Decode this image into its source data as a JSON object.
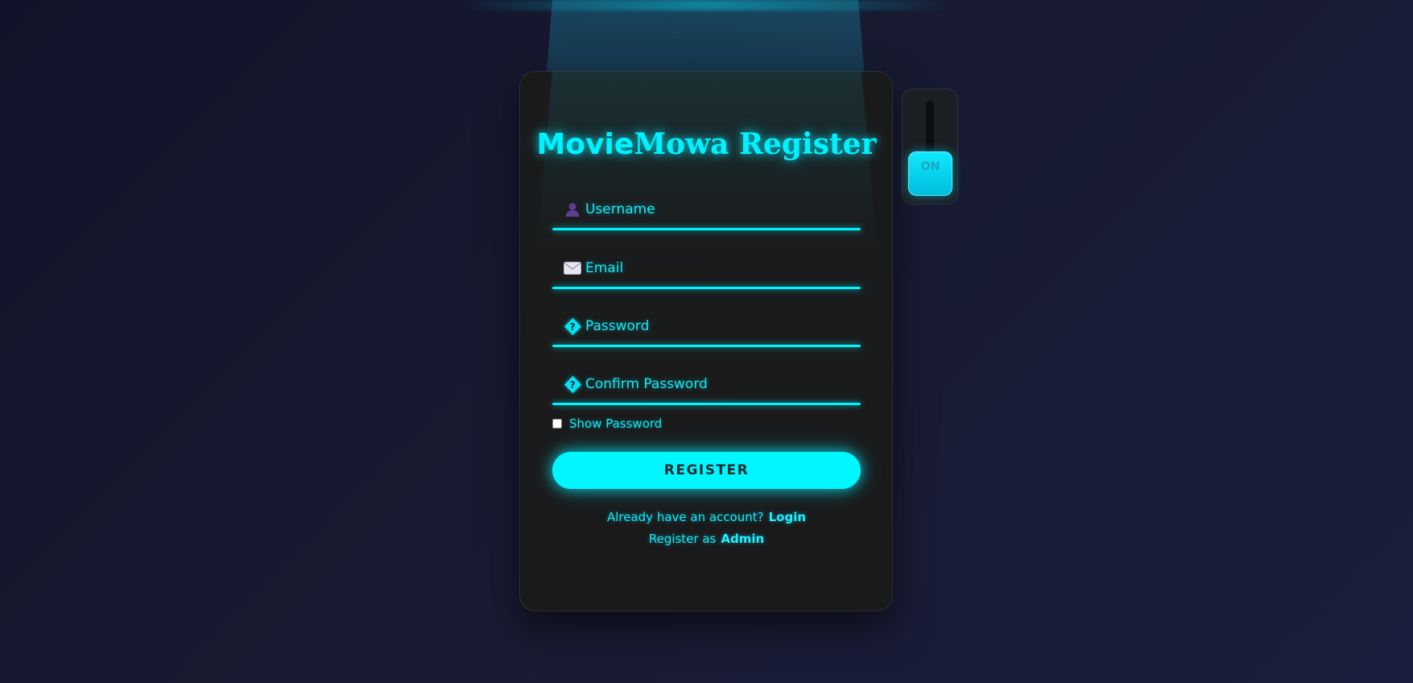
{
  "register_form": {
    "title_part1": "Movie",
    "title_part2": "Mowa Register",
    "fields": [
      {
        "name": "username",
        "placeholder": "Username",
        "icon": "user-icon"
      },
      {
        "name": "email",
        "placeholder": "Email",
        "icon": "envelope-icon"
      },
      {
        "name": "password",
        "placeholder": "Password",
        "icon": "lock-icon",
        "icon_glyph": "?"
      },
      {
        "name": "confirm_password",
        "placeholder": "Confirm Password",
        "icon": "lock-icon",
        "icon_glyph": "?"
      }
    ],
    "show_password_label": "Show Password",
    "show_password_checked": false,
    "register_label": "REGISTER",
    "login_prompt": "Already have an account?",
    "login_link": "Login",
    "admin_prompt": "Register as",
    "admin_link": "Admin"
  },
  "lamp_switch": {
    "label": "ON",
    "state": "on"
  },
  "colors": {
    "accent": "#00f2ff",
    "card_bg": "#1b1b1b",
    "page_bg": "#15172e"
  }
}
